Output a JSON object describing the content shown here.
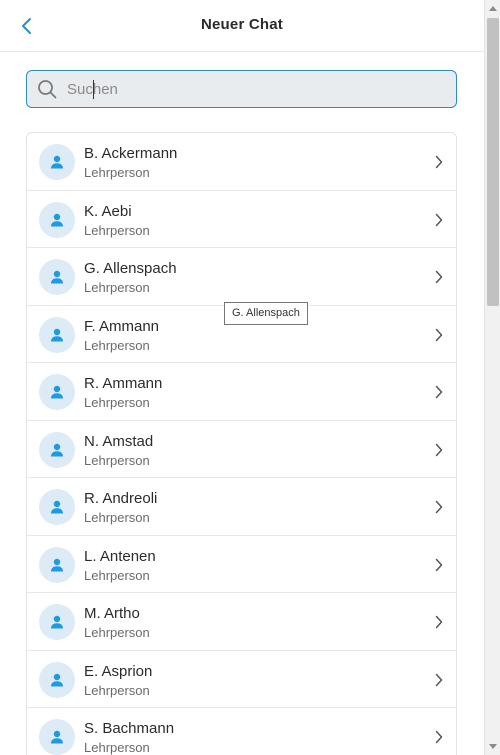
{
  "header": {
    "title": "Neuer Chat",
    "back_icon": "chevron-left-icon"
  },
  "search": {
    "placeholder": "Suchen",
    "value": ""
  },
  "colors": {
    "accent": "#2a8fbd",
    "avatar_bg": "#dcebf6",
    "avatar_fg": "#1e9be0"
  },
  "contacts": [
    {
      "name": "B. Ackermann",
      "role": "Lehrperson"
    },
    {
      "name": "K. Aebi",
      "role": "Lehrperson"
    },
    {
      "name": "G. Allenspach",
      "role": "Lehrperson"
    },
    {
      "name": "F. Ammann",
      "role": "Lehrperson"
    },
    {
      "name": "R. Ammann",
      "role": "Lehrperson"
    },
    {
      "name": "N. Amstad",
      "role": "Lehrperson"
    },
    {
      "name": "R. Andreoli",
      "role": "Lehrperson"
    },
    {
      "name": "L. Antenen",
      "role": "Lehrperson"
    },
    {
      "name": "M. Artho",
      "role": "Lehrperson"
    },
    {
      "name": "E. Asprion",
      "role": "Lehrperson"
    },
    {
      "name": "S. Bachmann",
      "role": "Lehrperson"
    }
  ],
  "tooltip": {
    "text": "G. Allenspach"
  }
}
